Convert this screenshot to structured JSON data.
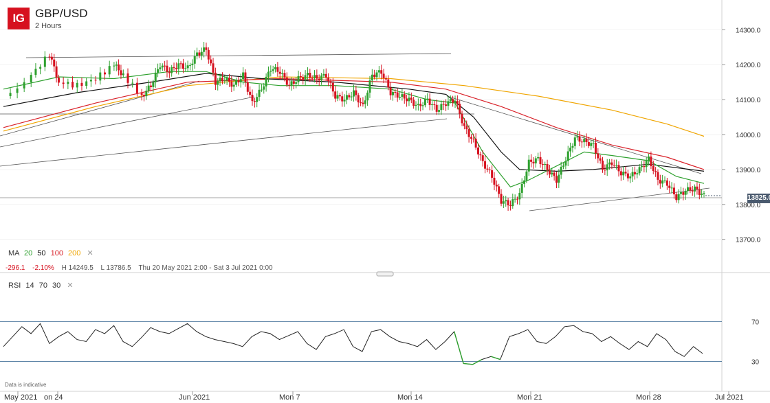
{
  "header": {
    "logo": "IG",
    "symbol": "GBP/USD",
    "timeframe": "2 Hours"
  },
  "indicators": {
    "ma_label": "MA",
    "ma_periods": [
      "20",
      "50",
      "100",
      "200"
    ],
    "ma_colors": [
      "#2ea02e",
      "#111111",
      "#d9222a",
      "#f0a500"
    ],
    "remove_icon": "close-icon",
    "rsi_label": "RSI",
    "rsi_params": [
      "14",
      "70",
      "30"
    ]
  },
  "stats": {
    "change": "-296.1",
    "change_pct": "-2.10%",
    "high": "H 14249.5",
    "low": "L 13786.5",
    "range": "Thu 20 May 2021 2:00 - Sat 3 Jul 2021 0:00"
  },
  "current_price": "13825.0",
  "footer_note": "Data is indicative",
  "colors": {
    "up": "#2ea02e",
    "down": "#d6111f",
    "accent": "#d6111f",
    "badge": "#4a5a6e"
  },
  "chart_data": {
    "type": "candlestick",
    "price_axis": {
      "ticks": [
        14300.0,
        14200.0,
        14100.0,
        14000.0,
        13900.0,
        13800.0,
        13700.0
      ],
      "tick_labels": [
        "14300.0",
        "14200.0",
        "14100.0",
        "14000.0",
        "13900.0",
        "13800.0",
        "13700.0"
      ],
      "ylim": [
        13605,
        14385
      ]
    },
    "x_labels": [
      "May 2021",
      "on 24",
      "Jun 2021",
      "Mon 7",
      "Mon 14",
      "Mon 21",
      "Mon 28",
      "Jul 2021"
    ],
    "close_path": [
      [
        0,
        14110
      ],
      [
        3,
        14170
      ],
      [
        5,
        14230
      ],
      [
        6,
        14150
      ],
      [
        8,
        14140
      ],
      [
        10,
        14160
      ],
      [
        12,
        14200
      ],
      [
        13,
        14170
      ],
      [
        15,
        14110
      ],
      [
        16,
        14140
      ],
      [
        17,
        14200
      ],
      [
        18,
        14180
      ],
      [
        19,
        14200
      ],
      [
        20,
        14190
      ],
      [
        21,
        14230
      ],
      [
        22,
        14245
      ],
      [
        23,
        14150
      ],
      [
        24,
        14160
      ],
      [
        25,
        14140
      ],
      [
        26,
        14170
      ],
      [
        27,
        14090
      ],
      [
        28,
        14130
      ],
      [
        29,
        14190
      ],
      [
        30,
        14180
      ],
      [
        31,
        14140
      ],
      [
        32,
        14160
      ],
      [
        33,
        14170
      ],
      [
        34,
        14160
      ],
      [
        35,
        14170
      ],
      [
        36,
        14110
      ],
      [
        37,
        14100
      ],
      [
        38,
        14120
      ],
      [
        39,
        14080
      ],
      [
        40,
        14170
      ],
      [
        41,
        14180
      ],
      [
        42,
        14120
      ],
      [
        43,
        14110
      ],
      [
        44,
        14100
      ],
      [
        45,
        14080
      ],
      [
        46,
        14100
      ],
      [
        47,
        14070
      ],
      [
        48,
        14090
      ],
      [
        49,
        14100
      ],
      [
        50,
        14020
      ],
      [
        51,
        13980
      ],
      [
        52,
        13920
      ],
      [
        53,
        13880
      ],
      [
        54,
        13810
      ],
      [
        55,
        13800
      ],
      [
        56,
        13830
      ],
      [
        57,
        13920
      ],
      [
        58,
        13930
      ],
      [
        59,
        13900
      ],
      [
        60,
        13870
      ],
      [
        61,
        13930
      ],
      [
        62,
        13990
      ],
      [
        63,
        13980
      ],
      [
        64,
        13970
      ],
      [
        65,
        13900
      ],
      [
        66,
        13920
      ],
      [
        67,
        13890
      ],
      [
        68,
        13880
      ],
      [
        69,
        13900
      ],
      [
        70,
        13930
      ],
      [
        71,
        13870
      ],
      [
        72,
        13860
      ],
      [
        73,
        13820
      ],
      [
        74,
        13840
      ],
      [
        75,
        13845
      ],
      [
        76,
        13825
      ]
    ],
    "ma20": [
      [
        0,
        14130
      ],
      [
        6,
        14165
      ],
      [
        12,
        14160
      ],
      [
        18,
        14180
      ],
      [
        22,
        14180
      ],
      [
        26,
        14150
      ],
      [
        30,
        14140
      ],
      [
        36,
        14140
      ],
      [
        42,
        14130
      ],
      [
        46,
        14100
      ],
      [
        49,
        14090
      ],
      [
        52,
        13950
      ],
      [
        55,
        13850
      ],
      [
        57,
        13870
      ],
      [
        60,
        13910
      ],
      [
        63,
        13950
      ],
      [
        66,
        13940
      ],
      [
        70,
        13925
      ],
      [
        73,
        13880
      ],
      [
        76,
        13860
      ]
    ],
    "ma50": [
      [
        0,
        14080
      ],
      [
        8,
        14120
      ],
      [
        16,
        14150
      ],
      [
        22,
        14175
      ],
      [
        28,
        14160
      ],
      [
        36,
        14150
      ],
      [
        44,
        14130
      ],
      [
        48,
        14115
      ],
      [
        51,
        14050
      ],
      [
        54,
        13950
      ],
      [
        56,
        13900
      ],
      [
        60,
        13895
      ],
      [
        64,
        13900
      ],
      [
        70,
        13915
      ],
      [
        76,
        13895
      ]
    ],
    "ma100": [
      [
        0,
        14020
      ],
      [
        10,
        14090
      ],
      [
        20,
        14150
      ],
      [
        30,
        14160
      ],
      [
        42,
        14150
      ],
      [
        48,
        14130
      ],
      [
        54,
        14080
      ],
      [
        60,
        14020
      ],
      [
        66,
        13970
      ],
      [
        72,
        13935
      ],
      [
        76,
        13900
      ]
    ],
    "ma200": [
      [
        0,
        14010
      ],
      [
        10,
        14080
      ],
      [
        20,
        14140
      ],
      [
        30,
        14165
      ],
      [
        42,
        14160
      ],
      [
        50,
        14140
      ],
      [
        58,
        14110
      ],
      [
        66,
        14070
      ],
      [
        72,
        14030
      ],
      [
        76,
        13995
      ]
    ],
    "rsi": {
      "levels": [
        70,
        30
      ],
      "level_labels": [
        "70",
        "30"
      ],
      "values": [
        45,
        55,
        65,
        58,
        68,
        48,
        55,
        60,
        52,
        50,
        62,
        58,
        66,
        50,
        45,
        54,
        64,
        60,
        58,
        63,
        68,
        60,
        55,
        52,
        50,
        48,
        45,
        55,
        60,
        58,
        52,
        56,
        60,
        48,
        42,
        55,
        58,
        62,
        45,
        40,
        60,
        62,
        55,
        50,
        48,
        45,
        52,
        42,
        50,
        60,
        28,
        27,
        32,
        35,
        32,
        55,
        58,
        62,
        50,
        48,
        55,
        65,
        66,
        60,
        58,
        50,
        55,
        48,
        42,
        50,
        45,
        58,
        52,
        40,
        35,
        45,
        38
      ]
    }
  }
}
